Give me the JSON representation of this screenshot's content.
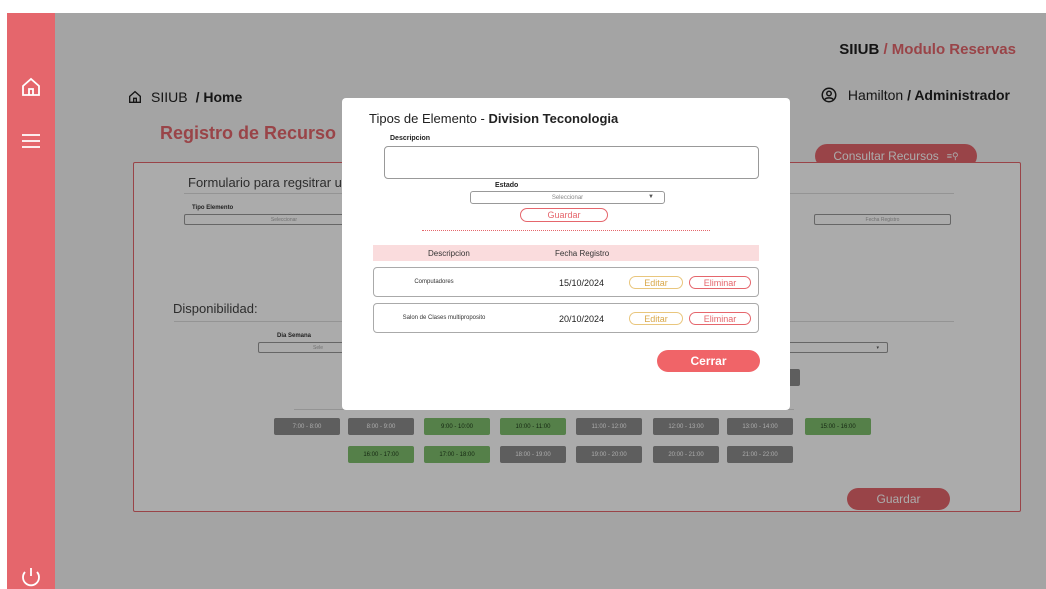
{
  "header": {
    "app_name": "SIIUB",
    "module": "/ Modulo Reservas",
    "breadcrumb_root": "SIIUB",
    "breadcrumb_page": "/ Home",
    "user_name": "Hamilton",
    "user_role": "/ Administrador"
  },
  "page": {
    "title": "Registro de Recurso",
    "consult_button": "Consultar Recursos",
    "consult_icon": "list-search-icon"
  },
  "form": {
    "subtitle": "Formulario para regsitrar un",
    "tipo_elemento_label": "Tipo Elemento",
    "tipo_elemento_placeholder": "Seleccionar",
    "fecha_registro_label": "Fecha Registro",
    "disponibilidad_title": "Disponibilidad:",
    "dia_semana_label": "Dia Semana",
    "dia_semana_placeholder": "Sele",
    "save_button": "Guardar"
  },
  "slots": [
    {
      "label": "7:00 - 8:00",
      "state": "gray"
    },
    {
      "label": "8:00 - 9:00",
      "state": "gray"
    },
    {
      "label": "9:00 - 10:00",
      "state": "green"
    },
    {
      "label": "10:00 - 11:00",
      "state": "green"
    },
    {
      "label": "11:00 - 12:00",
      "state": "gray"
    },
    {
      "label": "12:00 - 13:00",
      "state": "gray"
    },
    {
      "label": "13:00 - 14:00",
      "state": "gray"
    },
    {
      "label": "15:00 - 16:00",
      "state": "green"
    },
    {
      "label": "16:00 - 17:00",
      "state": "green"
    },
    {
      "label": "17:00 - 18:00",
      "state": "green"
    },
    {
      "label": "18:00 - 19:00",
      "state": "gray"
    },
    {
      "label": "19:00 - 20:00",
      "state": "gray"
    },
    {
      "label": "20:00 - 21:00",
      "state": "gray"
    },
    {
      "label": "21:00 - 22:00",
      "state": "gray"
    }
  ],
  "modal": {
    "title_prefix": "Tipos de Elemento - ",
    "title_bold": "Division Teconologia",
    "descripcion_label": "Descripcion",
    "estado_label": "Estado",
    "estado_placeholder": "Seleccionar",
    "guardar_button": "Guardar",
    "table_headers": [
      "Descripcion",
      "Fecha Registro"
    ],
    "rows": [
      {
        "descripcion": "Computadores",
        "fecha": "15/10/2024",
        "edit": "Editar",
        "delete": "Eliminar"
      },
      {
        "descripcion": "Salon de Clases multiproposito",
        "fecha": "20/10/2024",
        "edit": "Editar",
        "delete": "Eliminar"
      }
    ],
    "close_button": "Cerrar"
  },
  "colors": {
    "accent": "#e5666c",
    "slot_available": "#7fbf6e",
    "slot_unavailable": "#8c8c8c"
  }
}
